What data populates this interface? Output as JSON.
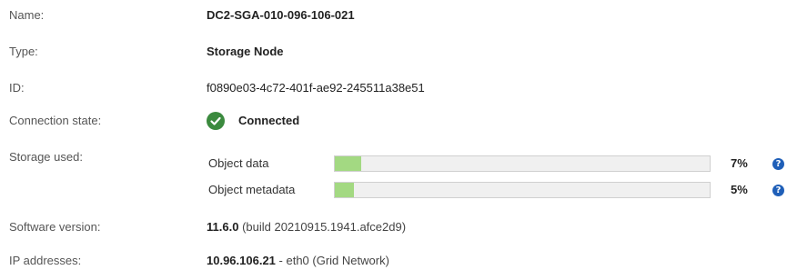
{
  "name": {
    "label": "Name:",
    "value": "DC2-SGA-010-096-106-021"
  },
  "type": {
    "label": "Type:",
    "value": "Storage Node"
  },
  "id": {
    "label": "ID:",
    "value": "f0890e03-4c72-401f-ae92-245511a38e51"
  },
  "connection": {
    "label": "Connection state:",
    "value": "Connected",
    "icon": "check-circle-icon",
    "icon_color": "#3b8a3e"
  },
  "storage": {
    "label": "Storage used:",
    "fill_color": "#a3d982",
    "items": [
      {
        "label": "Object data",
        "percent_text": "7%",
        "percent": 7,
        "help_icon": "?"
      },
      {
        "label": "Object metadata",
        "percent_text": "5%",
        "percent": 5,
        "help_icon": "?"
      }
    ]
  },
  "software": {
    "label": "Software version:",
    "version": "11.6.0",
    "build": "(build 20210915.1941.afce2d9)"
  },
  "ip": {
    "label": "IP addresses:",
    "address": "10.96.106.21",
    "detail": "- eth0 (Grid Network)"
  }
}
